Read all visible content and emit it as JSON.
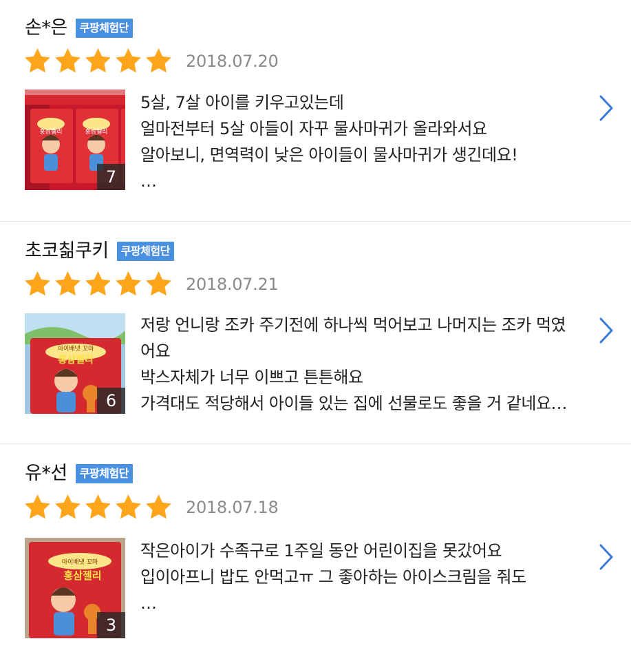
{
  "colors": {
    "badge": "#4a90e2",
    "star": "#ffa51c",
    "date": "#8a8a8a",
    "chevron": "#3b78d8"
  },
  "reviews": [
    {
      "name": "손*은",
      "badge": "쿠팡체험단",
      "stars": 5,
      "date": "2018.07.20",
      "photo_count": "7",
      "lines": [
        "5살, 7살 아이를 키우고있는데",
        "얼마전부터 5살 아들이 자꾸 물사마귀가 올라와서요",
        "알아보니, 면역력이 낮은 아이들이 물사마귀가 생긴데요!",
        "…"
      ]
    },
    {
      "name": "초코칢쿠키",
      "badge": "쿠팡체험단",
      "stars": 5,
      "date": "2018.07.21",
      "photo_count": "6",
      "lines": [
        "저랑 언니랑 조카 주기전에 하나씩 먹어보고 나머지는 조카 먹였",
        "어요",
        "박스자체가 너무 이쁘고 튼튼해요",
        "가격대도 적당해서 아이들 있는 집에 선물로도 좋을 거 같네요…"
      ]
    },
    {
      "name": "유*선",
      "badge": "쿠팡체험단",
      "stars": 5,
      "date": "2018.07.18",
      "photo_count": "3",
      "lines": [
        "작은아이가 수족구로 1주일 동안 어린이집을 못갔어요",
        "",
        "입이아프니 밥도 안먹고ㅠ 그 좋아하는 아이스크림을 줘도",
        "…"
      ]
    }
  ],
  "product_box": {
    "small_text": "아이배냇 꼬마",
    "brand_text": "홍삼젤리"
  }
}
